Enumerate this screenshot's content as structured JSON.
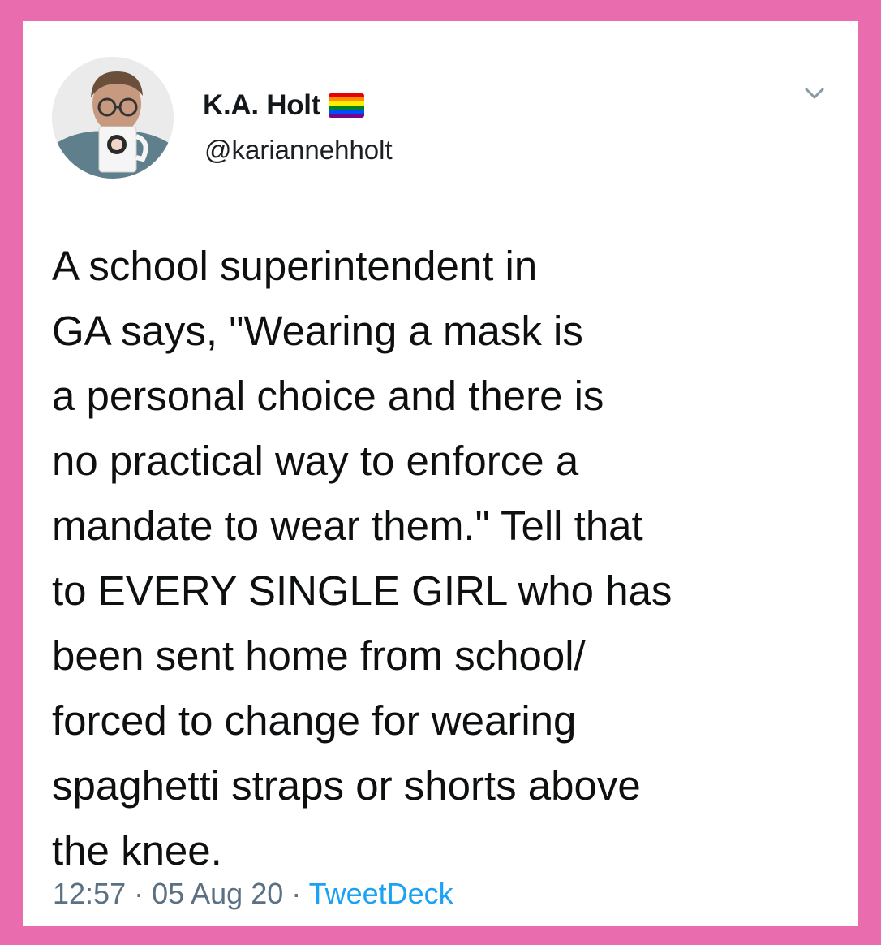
{
  "user": {
    "display_name": "K.A. Holt",
    "handle": "@kariannehholt",
    "avatar_icon": "profile-photo",
    "flag_icon": "rainbow-flag-icon",
    "flag_colors": [
      "#e40303",
      "#ff8c00",
      "#ffed00",
      "#008026",
      "#004dff",
      "#750787"
    ]
  },
  "tweet": {
    "text": "A school superintendent in\nGA says, \"Wearing a mask is\na personal choice and there is\nno practical way to enforce a\nmandate to wear them.\" Tell that\nto EVERY SINGLE GIRL who has\nbeen sent home from school/\nforced to change for wearing\nspaghetti straps or shorts above\nthe knee."
  },
  "meta": {
    "time": "12:57",
    "separator": " · ",
    "date": "05 Aug 20",
    "source": "TweetDeck"
  },
  "menu": {
    "icon": "chevron-down-icon"
  },
  "colors": {
    "border": "#e86cae",
    "text": "#0d0f10",
    "meta": "#5b7083",
    "link": "#1da1f2"
  }
}
